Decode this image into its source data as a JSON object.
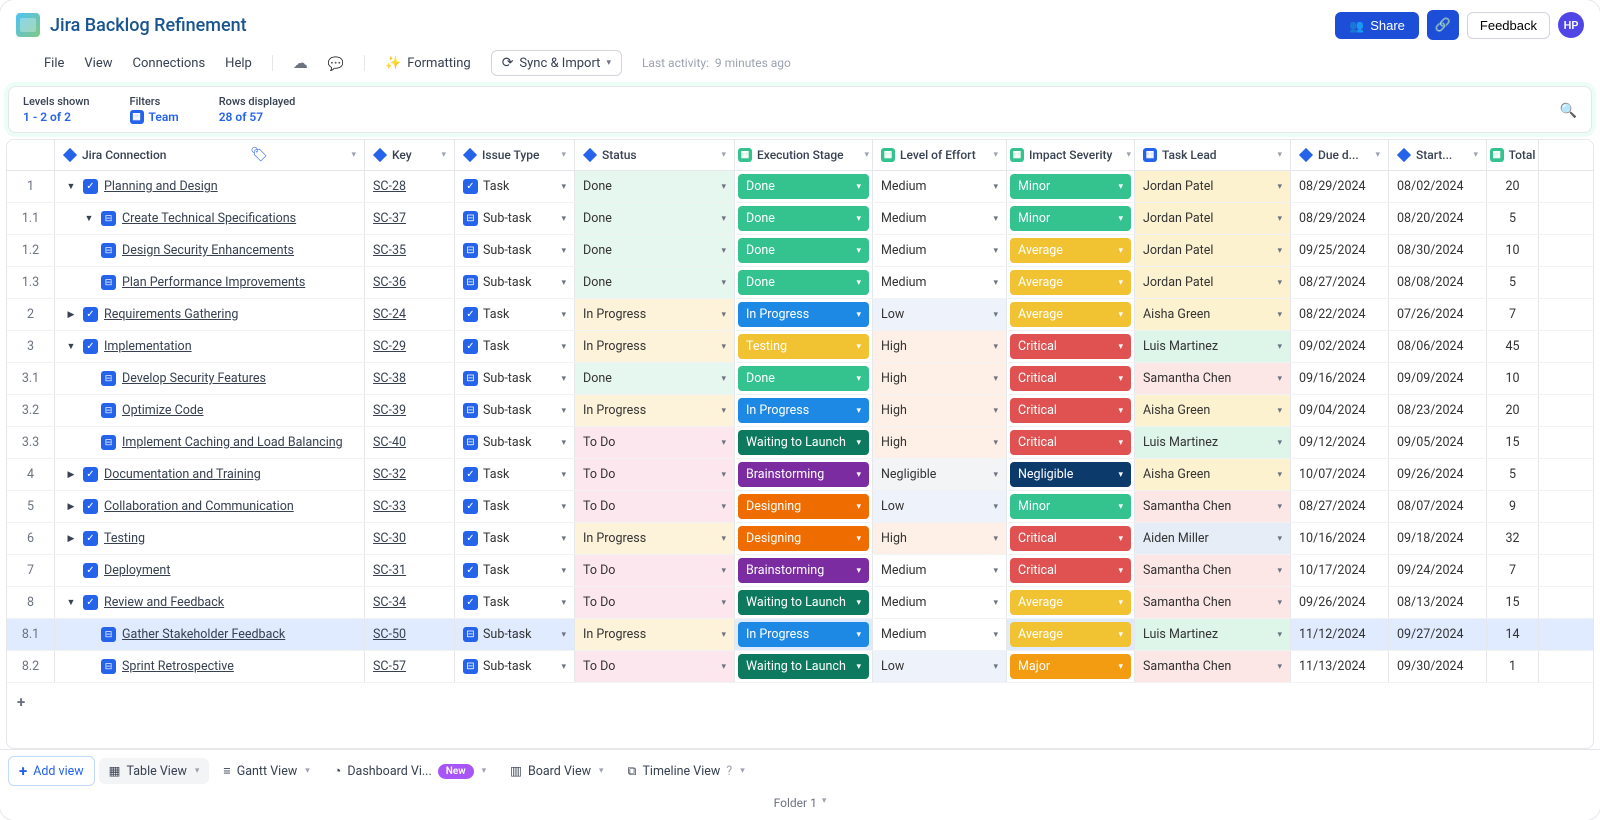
{
  "title": "Jira Backlog Refinement",
  "header": {
    "share": "Share",
    "feedback": "Feedback",
    "avatar": "HP"
  },
  "menu": {
    "file": "File",
    "view": "View",
    "connections": "Connections",
    "help": "Help",
    "formatting": "Formatting",
    "sync": "Sync & Import",
    "activityLabel": "Last activity:",
    "activityValue": "9 minutes ago"
  },
  "filters": {
    "levelsLabel": "Levels shown",
    "levelsValue": "1 - 2 of 2",
    "filtersLabel": "Filters",
    "filtersValue": "Team",
    "rowsLabel": "Rows displayed",
    "rowsValue": "28 of 57"
  },
  "columns": {
    "conn": "Jira Connection",
    "key": "Key",
    "issue": "Issue Type",
    "status": "Status",
    "stage": "Execution Stage",
    "effort": "Level of Effort",
    "impact": "Impact Severity",
    "lead": "Task Lead",
    "due": "Due d...",
    "start": "Start...",
    "total": "Total"
  },
  "colors": {
    "status": {
      "Done": "#e6f7f0",
      "In Progress": "#fdf3da",
      "To Do": "#fde7ef"
    },
    "stage": {
      "Done": "#34c38f",
      "In Progress": "#1e88e5",
      "Testing": "#f1c232",
      "Waiting to Launch": "#0d7a5f",
      "Brainstorming": "#7b2ca0",
      "Designing": "#ef6c00"
    },
    "effort": {
      "Medium": "#fff",
      "Low": "#eef2fa",
      "High": "#fef0e6",
      "Negligible": "#f3f4f6"
    },
    "impact": {
      "Minor": "#34c38f",
      "Average": "#f1c232",
      "Critical": "#e05252",
      "Negligible": "#0b3a6b",
      "Major": "#f39c12"
    },
    "lead": {
      "Jordan Patel": "#fdf2d0",
      "Aisha Green": "#fdf2d0",
      "Luis Martinez": "#def5ea",
      "Samantha Chen": "#fde6e6",
      "Aiden Miller": "#e6edf7"
    }
  },
  "rows": [
    {
      "num": "1",
      "indent": 0,
      "chev": "open",
      "icon": "task",
      "title": "Planning and Design",
      "key": "SC-28",
      "issue": "Task",
      "status": "Done",
      "stage": "Done",
      "effort": "Medium",
      "impact": "Minor",
      "lead": "Jordan Patel",
      "due": "08/29/2024",
      "start": "08/02/2024",
      "total": "20"
    },
    {
      "num": "1.1",
      "indent": 1,
      "chev": "open",
      "icon": "sub",
      "title": "Create Technical Specifications",
      "key": "SC-37",
      "issue": "Sub-task",
      "status": "Done",
      "stage": "Done",
      "effort": "Medium",
      "impact": "Minor",
      "lead": "Jordan Patel",
      "due": "08/29/2024",
      "start": "08/20/2024",
      "total": "5"
    },
    {
      "num": "1.2",
      "indent": 1,
      "chev": "none",
      "icon": "sub",
      "title": "Design Security Enhancements",
      "key": "SC-35",
      "issue": "Sub-task",
      "status": "Done",
      "stage": "Done",
      "effort": "Medium",
      "impact": "Average",
      "lead": "Jordan Patel",
      "due": "09/25/2024",
      "start": "08/30/2024",
      "total": "10"
    },
    {
      "num": "1.3",
      "indent": 1,
      "chev": "none",
      "icon": "sub",
      "title": "Plan Performance Improvements",
      "key": "SC-36",
      "issue": "Sub-task",
      "status": "Done",
      "stage": "Done",
      "effort": "Medium",
      "impact": "Average",
      "lead": "Jordan Patel",
      "due": "08/27/2024",
      "start": "08/08/2024",
      "total": "5"
    },
    {
      "num": "2",
      "indent": 0,
      "chev": "closed",
      "icon": "task",
      "title": "Requirements Gathering",
      "key": "SC-24",
      "issue": "Task",
      "status": "In Progress",
      "stage": "In Progress",
      "effort": "Low",
      "impact": "Average",
      "lead": "Aisha Green",
      "due": "08/22/2024",
      "start": "07/26/2024",
      "total": "7"
    },
    {
      "num": "3",
      "indent": 0,
      "chev": "open",
      "icon": "task",
      "title": "Implementation",
      "key": "SC-29",
      "issue": "Task",
      "status": "In Progress",
      "stage": "Testing",
      "effort": "High",
      "impact": "Critical",
      "lead": "Luis Martinez",
      "due": "09/02/2024",
      "start": "08/06/2024",
      "total": "45"
    },
    {
      "num": "3.1",
      "indent": 1,
      "chev": "none",
      "icon": "sub",
      "title": "Develop Security Features",
      "key": "SC-38",
      "issue": "Sub-task",
      "status": "Done",
      "stage": "Done",
      "effort": "High",
      "impact": "Critical",
      "lead": "Samantha Chen",
      "due": "09/16/2024",
      "start": "09/09/2024",
      "total": "10"
    },
    {
      "num": "3.2",
      "indent": 1,
      "chev": "none",
      "icon": "sub",
      "title": "Optimize Code",
      "key": "SC-39",
      "issue": "Sub-task",
      "status": "In Progress",
      "stage": "In Progress",
      "effort": "High",
      "impact": "Critical",
      "lead": "Aisha Green",
      "due": "09/04/2024",
      "start": "08/23/2024",
      "total": "20"
    },
    {
      "num": "3.3",
      "indent": 1,
      "chev": "none",
      "icon": "sub",
      "title": "Implement Caching and Load Balancing",
      "key": "SC-40",
      "issue": "Sub-task",
      "status": "To Do",
      "stage": "Waiting to Launch",
      "effort": "High",
      "impact": "Critical",
      "lead": "Luis Martinez",
      "due": "09/12/2024",
      "start": "09/05/2024",
      "total": "15"
    },
    {
      "num": "4",
      "indent": 0,
      "chev": "closed",
      "icon": "task",
      "title": "Documentation and Training",
      "key": "SC-32",
      "issue": "Task",
      "status": "To Do",
      "stage": "Brainstorming",
      "effort": "Negligible",
      "impact": "Negligible",
      "lead": "Aisha Green",
      "due": "10/07/2024",
      "start": "09/26/2024",
      "total": "5"
    },
    {
      "num": "5",
      "indent": 0,
      "chev": "closed",
      "icon": "task",
      "title": "Collaboration and Communication",
      "key": "SC-33",
      "issue": "Task",
      "status": "To Do",
      "stage": "Designing",
      "effort": "Low",
      "impact": "Minor",
      "lead": "Samantha Chen",
      "due": "08/27/2024",
      "start": "08/07/2024",
      "total": "9"
    },
    {
      "num": "6",
      "indent": 0,
      "chev": "closed",
      "icon": "task",
      "title": "Testing",
      "key": "SC-30",
      "issue": "Task",
      "status": "In Progress",
      "stage": "Designing",
      "effort": "High",
      "impact": "Critical",
      "lead": "Aiden Miller",
      "due": "10/16/2024",
      "start": "09/18/2024",
      "total": "32"
    },
    {
      "num": "7",
      "indent": 0,
      "chev": "none",
      "icon": "task",
      "title": "Deployment",
      "key": "SC-31",
      "issue": "Task",
      "status": "To Do",
      "stage": "Brainstorming",
      "effort": "Medium",
      "impact": "Critical",
      "lead": "Samantha Chen",
      "due": "10/17/2024",
      "start": "09/24/2024",
      "total": "7"
    },
    {
      "num": "8",
      "indent": 0,
      "chev": "open",
      "icon": "task",
      "title": "Review and Feedback",
      "key": "SC-34",
      "issue": "Task",
      "status": "To Do",
      "stage": "Waiting to Launch",
      "effort": "Medium",
      "impact": "Average",
      "lead": "Samantha Chen",
      "due": "09/26/2024",
      "start": "08/13/2024",
      "total": "15"
    },
    {
      "num": "8.1",
      "indent": 1,
      "chev": "none",
      "icon": "sub",
      "title": "Gather Stakeholder Feedback",
      "key": "SC-50",
      "issue": "Sub-task",
      "status": "In Progress",
      "stage": "In Progress",
      "effort": "Medium",
      "impact": "Average",
      "lead": "Luis Martinez",
      "due": "11/12/2024",
      "start": "09/27/2024",
      "total": "14",
      "sel": true
    },
    {
      "num": "8.2",
      "indent": 1,
      "chev": "none",
      "icon": "sub",
      "title": "Sprint Retrospective",
      "key": "SC-57",
      "issue": "Sub-task",
      "status": "To Do",
      "stage": "Waiting to Launch",
      "effort": "Low",
      "impact": "Major",
      "lead": "Samantha Chen",
      "due": "11/13/2024",
      "start": "09/30/2024",
      "total": "1"
    }
  ],
  "tabs": {
    "add": "Add view",
    "table": "Table View",
    "gantt": "Gantt View",
    "dashboard": "Dashboard Vi...",
    "newBadge": "New",
    "board": "Board View",
    "timeline": "Timeline View"
  },
  "folder": "Folder 1"
}
